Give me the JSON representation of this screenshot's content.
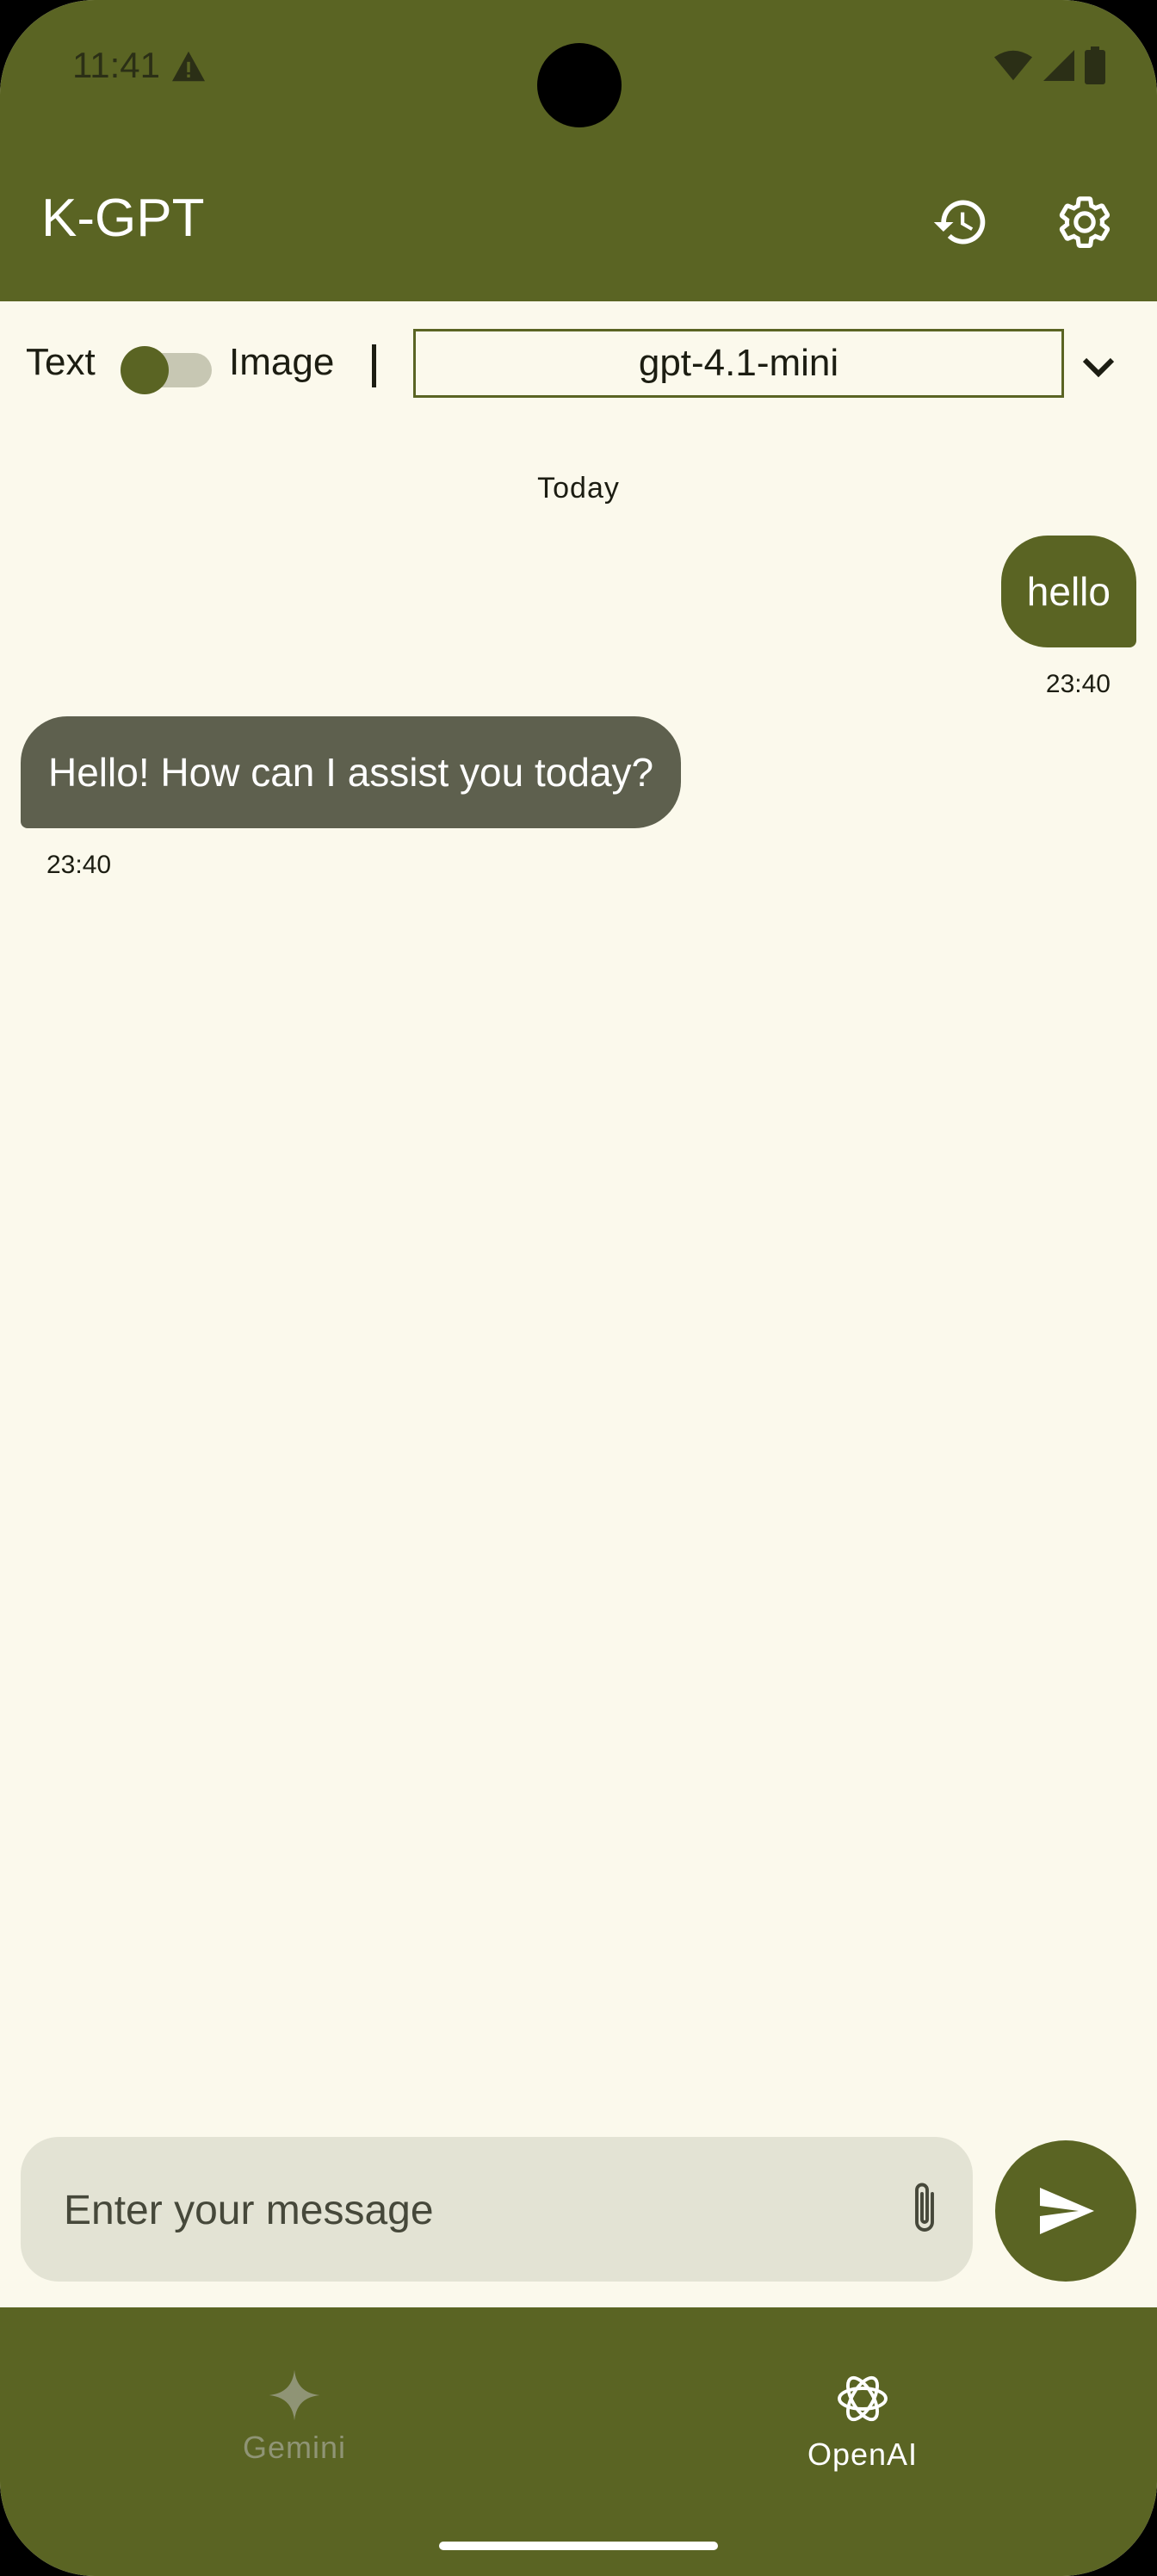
{
  "status_bar": {
    "time": "11:41",
    "icons": [
      "warning-icon",
      "wifi-icon",
      "signal-icon",
      "battery-icon"
    ]
  },
  "app_bar": {
    "title": "K-GPT",
    "actions": [
      "history-icon",
      "settings-gear-icon"
    ]
  },
  "controls": {
    "text_label": "Text",
    "image_label": "Image",
    "mode_toggle_on": false,
    "model_selected": "gpt-4.1-mini"
  },
  "chat": {
    "date_separator": "Today",
    "messages": [
      {
        "role": "user",
        "text": "hello",
        "time": "23:40"
      },
      {
        "role": "assistant",
        "text": "Hello! How can I assist you today?",
        "time": "23:40"
      }
    ]
  },
  "composer": {
    "placeholder": "Enter your message",
    "value": ""
  },
  "bottom_nav": {
    "items": [
      {
        "label": "Gemini",
        "icon": "gemini-sparkle-icon",
        "active": false
      },
      {
        "label": "OpenAI",
        "icon": "openai-logo-icon",
        "active": true
      }
    ]
  },
  "colors": {
    "primary": "#5a6423",
    "background": "#fbf9ec",
    "assistant_bubble": "#5e604e",
    "input_background": "#e3e3d4"
  }
}
